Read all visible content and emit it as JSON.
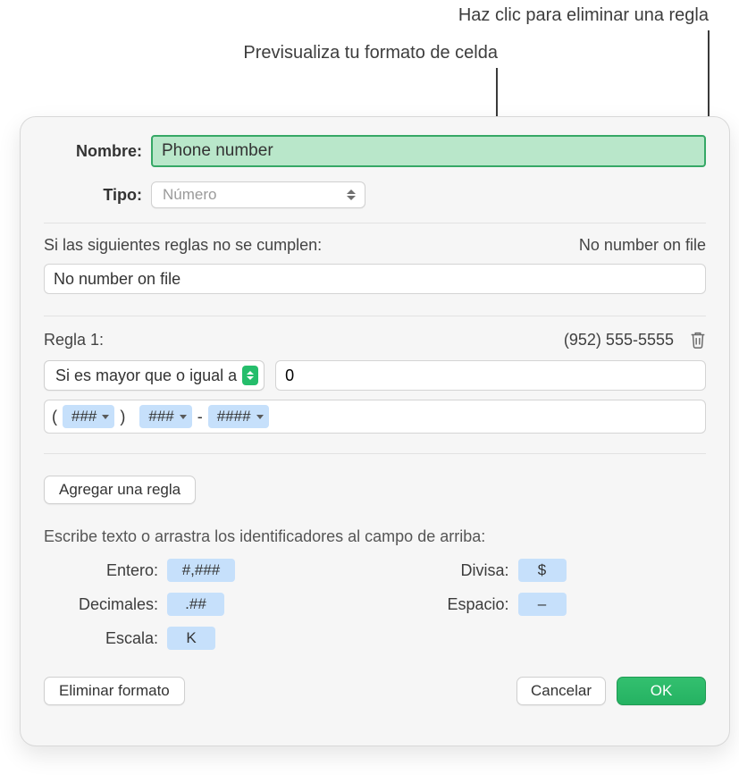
{
  "callouts": {
    "delete_rule": "Haz clic para eliminar una regla",
    "preview_format": "Previsualiza tu formato de celda"
  },
  "dialog": {
    "name_label": "Nombre:",
    "name_value": "Phone number",
    "type_label": "Tipo:",
    "type_value": "Número",
    "default_rule_heading": "Si las siguientes reglas no se cumplen:",
    "default_rule_preview": "No number on file",
    "default_rule_value": "No number on file",
    "rule1": {
      "title": "Regla 1:",
      "preview": "(952) 555-5555",
      "condition": "Si es mayor que o igual a",
      "value": "0",
      "format_tokens": {
        "open_paren": "(",
        "t1": "###",
        "close_paren": ")",
        "t2": "###",
        "dash": "-",
        "t3": "####"
      }
    },
    "add_rule": "Agregar una regla",
    "help_text": "Escribe texto o arrastra los identificadores al campo de arriba:",
    "tokens": {
      "entero_label": "Entero:",
      "entero_value": "#,###",
      "decimales_label": "Decimales:",
      "decimales_value": ".##",
      "escala_label": "Escala:",
      "escala_value": "K",
      "divisa_label": "Divisa:",
      "divisa_value": "$",
      "espacio_label": "Espacio:",
      "espacio_value": "–"
    },
    "footer": {
      "delete_format": "Eliminar formato",
      "cancel": "Cancelar",
      "ok": "OK"
    }
  }
}
